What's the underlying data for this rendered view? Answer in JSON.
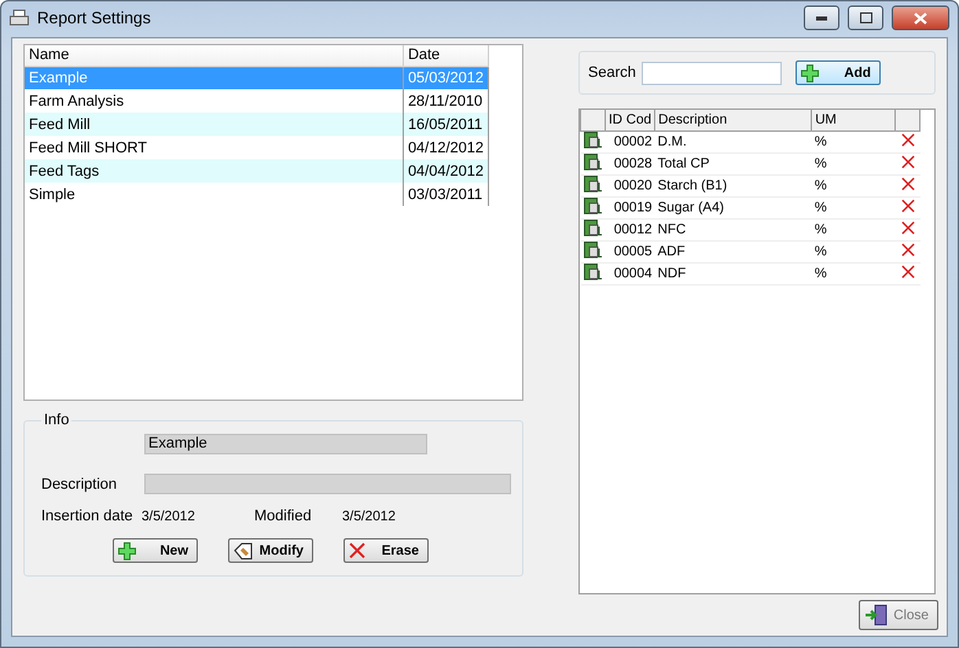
{
  "window": {
    "title": "Report Settings"
  },
  "reports": {
    "columns": [
      "Name",
      "Date"
    ],
    "rows": [
      {
        "name": "Example",
        "date": "05/03/2012",
        "selected": true
      },
      {
        "name": "Farm Analysis",
        "date": "28/11/2010",
        "selected": false
      },
      {
        "name": "Feed Mill",
        "date": "16/05/2011",
        "selected": false
      },
      {
        "name": "Feed Mill SHORT",
        "date": "04/12/2012",
        "selected": false
      },
      {
        "name": "Feed Tags",
        "date": "04/04/2012",
        "selected": false
      },
      {
        "name": "Simple",
        "date": "03/03/2011",
        "selected": false
      }
    ]
  },
  "info": {
    "legend": "Info",
    "name": "Example",
    "description_label": "Description",
    "insertion_label": "Insertion date",
    "insertion_date": "3/5/2012",
    "modified_label": "Modified",
    "modified_date": "3/5/2012",
    "buttons": [
      {
        "label": "New",
        "kind": "new"
      },
      {
        "label": "Modify",
        "kind": "modify"
      },
      {
        "label": "Erase",
        "kind": "erase"
      }
    ]
  },
  "search": {
    "label": "Search",
    "add_button": "Add"
  },
  "components": {
    "columns": [
      "ID Cod",
      "Description",
      "UM"
    ],
    "rows": [
      {
        "id": "00002",
        "description": "D.M.",
        "um": "%"
      },
      {
        "id": "00028",
        "description": "Total CP",
        "um": "%"
      },
      {
        "id": "00020",
        "description": "Starch (B1)",
        "um": "%"
      },
      {
        "id": "00019",
        "description": "Sugar (A4)",
        "um": "%"
      },
      {
        "id": "00012",
        "description": "NFC",
        "um": "%"
      },
      {
        "id": "00005",
        "description": "ADF",
        "um": "%"
      },
      {
        "id": "00004",
        "description": "NDF",
        "um": "%"
      }
    ]
  },
  "close_button": "Close"
}
